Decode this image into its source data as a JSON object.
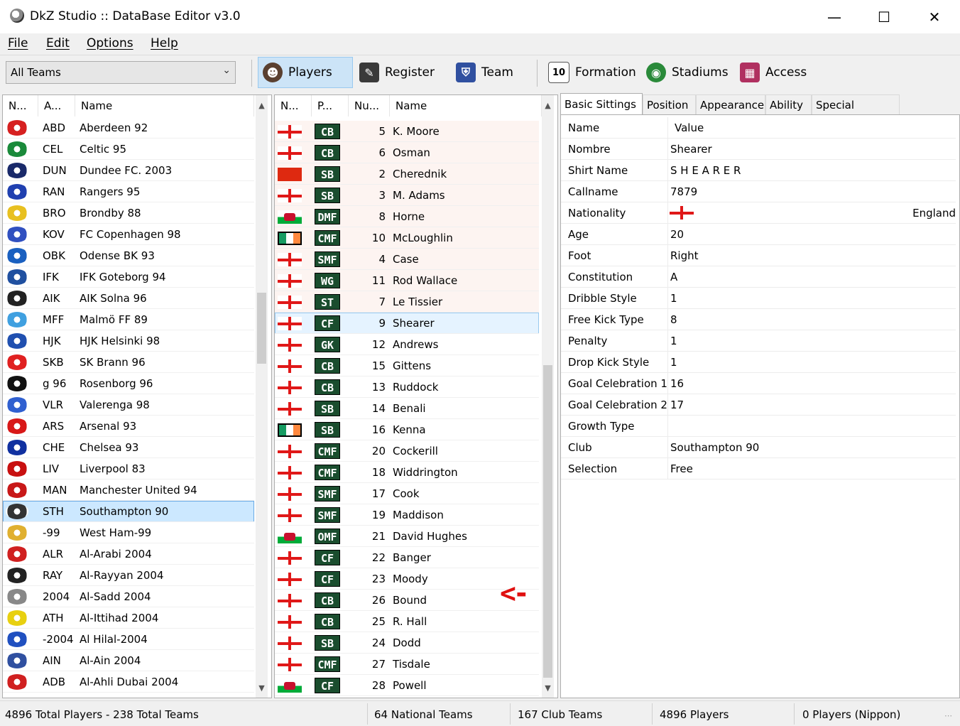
{
  "window": {
    "title": "DkZ Studio :: DataBase Editor v3.0",
    "minimize": "—",
    "maximize": "☐",
    "close": "✕"
  },
  "menu": [
    "File",
    "Edit",
    "Options",
    "Help"
  ],
  "team_filter": {
    "value": "All Teams"
  },
  "toolbar": [
    {
      "label": "Players",
      "icon": "player-icon",
      "active": true
    },
    {
      "label": "Register",
      "icon": "register-icon",
      "active": false
    },
    {
      "label": "Team",
      "icon": "team-icon",
      "active": false
    },
    {
      "label": "Formation",
      "icon": "formation-icon",
      "active": false
    },
    {
      "label": "Stadiums",
      "icon": "stadium-icon",
      "active": false
    },
    {
      "label": "Access",
      "icon": "access-icon",
      "active": false
    }
  ],
  "teams": {
    "headers": [
      "N...",
      "A...",
      "Name"
    ],
    "selected_index": 18,
    "rows": [
      {
        "abbr": "ABD",
        "name": "Aberdeen 92",
        "color": "#d62020"
      },
      {
        "abbr": "CEL",
        "name": "Celtic 95",
        "color": "#1a8a3a"
      },
      {
        "abbr": "DUN",
        "name": "Dundee FC. 2003",
        "color": "#1a2a6a"
      },
      {
        "abbr": "RAN",
        "name": "Rangers 95",
        "color": "#2040b0"
      },
      {
        "abbr": "BRO",
        "name": "Brondby 88",
        "color": "#e8c020"
      },
      {
        "abbr": "KOV",
        "name": "FC Copenhagen 98",
        "color": "#3050c0"
      },
      {
        "abbr": "OBK",
        "name": "Odense BK 93",
        "color": "#1a60c0"
      },
      {
        "abbr": "IFK",
        "name": "IFK Goteborg 94",
        "color": "#2050a0"
      },
      {
        "abbr": "AIK",
        "name": "AIK Solna 96",
        "color": "#222222"
      },
      {
        "abbr": "MFF",
        "name": "Malmö FF 89",
        "color": "#40a0e0"
      },
      {
        "abbr": "HJK",
        "name": "HJK Helsinki 98",
        "color": "#2050b0"
      },
      {
        "abbr": "SKB",
        "name": "SK Brann 96",
        "color": "#e02020"
      },
      {
        "abbr": "g 96",
        "name": "Rosenborg 96",
        "color": "#111111"
      },
      {
        "abbr": "VLR",
        "name": "Valerenga 98",
        "color": "#3060d0"
      },
      {
        "abbr": "ARS",
        "name": "Arsenal 93",
        "color": "#d81818"
      },
      {
        "abbr": "CHE",
        "name": "Chelsea 93",
        "color": "#1030a0"
      },
      {
        "abbr": "LIV",
        "name": "Liverpool 83",
        "color": "#c81010"
      },
      {
        "abbr": "MAN",
        "name": "Manchester United 94",
        "color": "#c81818"
      },
      {
        "abbr": "STH",
        "name": "Southampton 90",
        "color": "#333333"
      },
      {
        "abbr": "-99",
        "name": "West Ham-99",
        "color": "#e0b030"
      },
      {
        "abbr": "ALR",
        "name": "Al-Arabi 2004",
        "color": "#d02020"
      },
      {
        "abbr": "RAY",
        "name": "Al-Rayyan 2004",
        "color": "#222222"
      },
      {
        "abbr": "2004",
        "name": "Al-Sadd 2004",
        "color": "#888888"
      },
      {
        "abbr": "ATH",
        "name": "Al-Ittihad 2004",
        "color": "#e8d010"
      },
      {
        "abbr": "-2004",
        "name": "Al Hilal-2004",
        "color": "#2050c0"
      },
      {
        "abbr": "AIN",
        "name": "Al-Ain 2004",
        "color": "#3050a0"
      },
      {
        "abbr": "ADB",
        "name": "Al-Ahli Dubai 2004",
        "color": "#d02020"
      }
    ]
  },
  "players": {
    "headers": [
      "N...",
      "P...",
      "Nu...",
      "Name"
    ],
    "selected_index": 9,
    "rows": [
      {
        "flag": "eng",
        "pos": "CB",
        "num": "5",
        "name": "K. Moore"
      },
      {
        "flag": "eng",
        "pos": "CB",
        "num": "6",
        "name": "Osman"
      },
      {
        "flag": "chn",
        "pos": "SB",
        "num": "2",
        "name": "Cherednik"
      },
      {
        "flag": "eng",
        "pos": "SB",
        "num": "3",
        "name": "M. Adams"
      },
      {
        "flag": "wal",
        "pos": "DMF",
        "num": "8",
        "name": "Horne"
      },
      {
        "flag": "irl",
        "pos": "CMF",
        "num": "10",
        "name": "McLoughlin"
      },
      {
        "flag": "eng",
        "pos": "SMF",
        "num": "4",
        "name": "Case"
      },
      {
        "flag": "eng",
        "pos": "WG",
        "num": "11",
        "name": "Rod Wallace"
      },
      {
        "flag": "eng",
        "pos": "ST",
        "num": "7",
        "name": "Le Tissier"
      },
      {
        "flag": "eng",
        "pos": "CF",
        "num": "9",
        "name": "Shearer"
      },
      {
        "flag": "eng",
        "pos": "GK",
        "num": "12",
        "name": "Andrews"
      },
      {
        "flag": "eng",
        "pos": "CB",
        "num": "15",
        "name": "Gittens"
      },
      {
        "flag": "eng",
        "pos": "CB",
        "num": "13",
        "name": "Ruddock"
      },
      {
        "flag": "eng",
        "pos": "SB",
        "num": "14",
        "name": "Benali"
      },
      {
        "flag": "irl",
        "pos": "SB",
        "num": "16",
        "name": "Kenna"
      },
      {
        "flag": "eng",
        "pos": "CMF",
        "num": "20",
        "name": "Cockerill"
      },
      {
        "flag": "eng",
        "pos": "CMF",
        "num": "18",
        "name": "Widdrington"
      },
      {
        "flag": "eng",
        "pos": "SMF",
        "num": "17",
        "name": "Cook"
      },
      {
        "flag": "eng",
        "pos": "SMF",
        "num": "19",
        "name": "Maddison"
      },
      {
        "flag": "wal",
        "pos": "OMF",
        "num": "21",
        "name": "David Hughes"
      },
      {
        "flag": "eng",
        "pos": "CF",
        "num": "22",
        "name": "Banger"
      },
      {
        "flag": "eng",
        "pos": "CF",
        "num": "23",
        "name": "Moody"
      },
      {
        "flag": "eng",
        "pos": "CB",
        "num": "26",
        "name": "Bound"
      },
      {
        "flag": "eng",
        "pos": "CB",
        "num": "25",
        "name": "R. Hall"
      },
      {
        "flag": "eng",
        "pos": "SB",
        "num": "24",
        "name": "Dodd"
      },
      {
        "flag": "eng",
        "pos": "CMF",
        "num": "27",
        "name": "Tisdale"
      },
      {
        "flag": "wal",
        "pos": "CF",
        "num": "28",
        "name": "Powell"
      }
    ]
  },
  "annotation": "<-",
  "tabs": [
    "Basic Sittings",
    "Position",
    "Appearance",
    "Ability",
    "Special Abilities"
  ],
  "active_tab": 0,
  "properties": {
    "header": {
      "name": "Name",
      "value": "Value"
    },
    "rows": [
      {
        "name": "Nombre",
        "value": "Shearer"
      },
      {
        "name": "Shirt Name",
        "value": "S H E A R E R"
      },
      {
        "name": "Callname",
        "value": "7879"
      },
      {
        "name": "Nationality",
        "value": "",
        "flag": "eng",
        "extra": "England"
      },
      {
        "name": "Age",
        "value": "20"
      },
      {
        "name": "Foot",
        "value": "Right"
      },
      {
        "name": "Constitution",
        "value": "A"
      },
      {
        "name": "Dribble Style",
        "value": "1"
      },
      {
        "name": "Free Kick Type",
        "value": "8"
      },
      {
        "name": "Penalty",
        "value": "1"
      },
      {
        "name": "Drop Kick Style",
        "value": "1"
      },
      {
        "name": "Goal Celebration 1",
        "value": "16"
      },
      {
        "name": "Goal Celebration 2",
        "value": "17"
      },
      {
        "name": "Growth Type",
        "value": ""
      },
      {
        "name": "Club",
        "value": "Southampton 90"
      },
      {
        "name": "Selection",
        "value": "Free"
      }
    ]
  },
  "status": [
    "4896 Total Players  -  238 Total Teams",
    "64 National Teams",
    "167 Club Teams",
    "4896 Players",
    "0 Players (Nippon)"
  ]
}
